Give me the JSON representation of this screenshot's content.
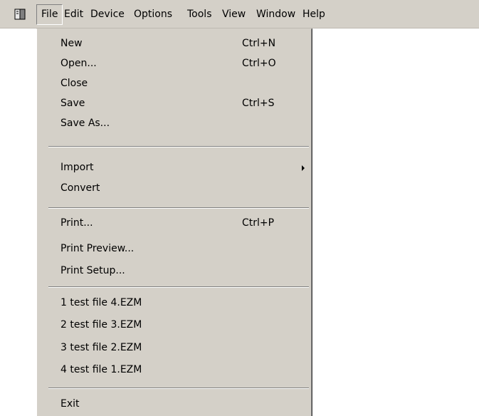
{
  "menubar": {
    "app_icon": "document-icon",
    "items": [
      {
        "label": "File",
        "active": true
      },
      {
        "label": "Edit"
      },
      {
        "label": "Device"
      },
      {
        "label": "Options"
      },
      {
        "label": "Tools"
      },
      {
        "label": "View"
      },
      {
        "label": "Window"
      },
      {
        "label": "Help"
      }
    ]
  },
  "file_menu": {
    "items": [
      {
        "label": "New",
        "shortcut": "Ctrl+N"
      },
      {
        "label": "Open...",
        "shortcut": "Ctrl+O"
      },
      {
        "label": "Close",
        "shortcut": ""
      },
      {
        "label": "Save",
        "shortcut": "Ctrl+S"
      },
      {
        "label": "Save As...",
        "shortcut": ""
      },
      {
        "label": "Import",
        "submenu": true
      },
      {
        "label": "Convert"
      },
      {
        "label": "Print...",
        "shortcut": "Ctrl+P"
      },
      {
        "label": "Print Preview..."
      },
      {
        "label": "Print Setup..."
      },
      {
        "label": "1 test file 4.EZM"
      },
      {
        "label": "2 test file 3.EZM"
      },
      {
        "label": "3 test file 2.EZM"
      },
      {
        "label": "4 test file 1.EZM"
      },
      {
        "label": "Exit"
      }
    ]
  },
  "colors": {
    "menu_face": "#d4d0c8",
    "shadow": "#808080",
    "highlight": "#ffffff"
  }
}
